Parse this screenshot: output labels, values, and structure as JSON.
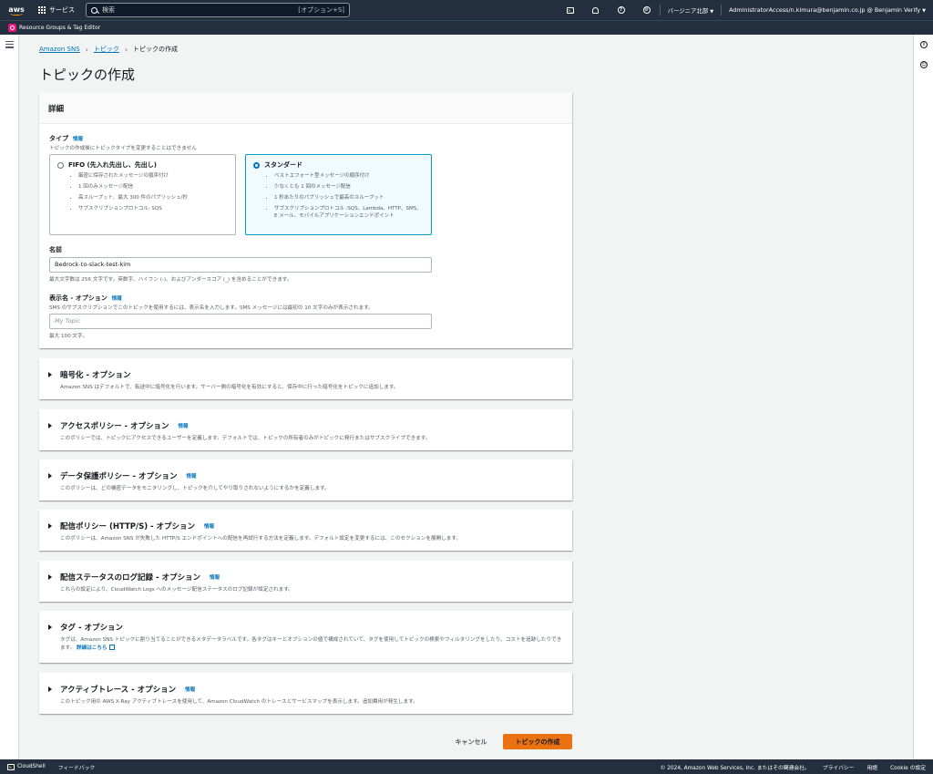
{
  "topnav": {
    "logo": "aws",
    "services": "サービス",
    "search_placeholder": "検索",
    "search_shortcut": "[オプション+S]",
    "region": "バージニア北部",
    "account": "AdministratorAccess/n.kimura@benjamin.co.jp @ Benjamin Verify"
  },
  "subnav": {
    "label": "Resource Groups & Tag Editor"
  },
  "breadcrumb": {
    "item1": "Amazon SNS",
    "item2": "トピック",
    "current": "トピックの作成"
  },
  "page_title": "トピックの作成",
  "details": {
    "header": "詳細",
    "type_label": "タイプ",
    "info": "情報",
    "type_desc": "トピックの作成後にトピックタイプを変更することはできません",
    "fifo": {
      "title": "FIFO (先入れ先出し、先出し)",
      "bullets": [
        "厳密に保存されたメッセージの順序付け",
        "1 回のみメッセージ配信",
        "高スループット、最大 300 件のパブリッシュ/秒",
        "サブスクリプションプロトコル: SQS"
      ]
    },
    "standard": {
      "title": "スタンダード",
      "bullets": [
        "ベストエフォート型メッセージの順序付け",
        "少なくとも 1 回のメッセージ配信",
        "1 秒あたりのパブリッシュで最高のスループット",
        "サブスクリプションプロトコル :SQS、Lambda、HTTP、SMS、E メール、モバイルアプリケーションエンドポイント"
      ]
    },
    "name_label": "名前",
    "name_value": "Bedrock-to-slack-test-kim",
    "name_hint": "最大文字数は 256 文字です。英数字、ハイフン (-)、およびアンダースコア (_) を含めることができます。",
    "display_label": "表示名 - オプション",
    "display_desc": "SMS のサブスクリプションでこのトピックを使用するには、表示名を入力します。SMS メッセージには最初の 10 文字のみが表示されます。",
    "display_placeholder": "My Topic",
    "display_hint": "最大 100 文字。"
  },
  "sections": [
    {
      "title": "暗号化 - オプション",
      "info": "",
      "desc": "Amazon SNS はデフォルトで、転送中に暗号化を行います。サーバー側の暗号化を有効にすると、保存中に行った暗号化をトピックに追加します。"
    },
    {
      "title": "アクセスポリシー - オプション",
      "info": "情報",
      "desc": "このポリシーでは、トピックにアクセスできるユーザーを定義します。デフォルトでは、トピックの所有者のみがトピックに発行またはサブスクライブできます。"
    },
    {
      "title": "データ保護ポリシー - オプション",
      "info": "情報",
      "desc": "このポリシーは、どの機密データをモニタリングし、トピックを介してやり取りされないようにするかを定義します。"
    },
    {
      "title": "配信ポリシー (HTTP/S) - オプション",
      "info": "情報",
      "desc": "このポリシーは、Amazon SNS が失敗した HTTP/S エンドポイントへの配信を再試行する方法を定義します。デフォルト設定を変更するには、このセクションを展開します。"
    },
    {
      "title": "配信ステータスのログ記録 - オプション",
      "info": "情報",
      "desc": "これらの設定により、CloudWatch Logs へのメッセージ配信ステータスのログ記録が設定されます。"
    },
    {
      "title": "タグ - オプション",
      "info": "",
      "desc": "タグは、Amazon SNS トピックに割り当てることができるメタデータラベルです。各タグはキーとオプションの値で構成されていて、タグを使用してトピックの検索やフィルタリングをしたり、コストを追跡したりできます。",
      "link": "詳細はこちら"
    },
    {
      "title": "アクティブトレース - オプション",
      "info": "情報",
      "desc": "このトピック用の AWS X-Ray アクティブトレースを使用して、Amazon CloudWatch のトレースとサービスマップを表示します。追加費用が発生します。"
    }
  ],
  "buttons": {
    "cancel": "キャンセル",
    "create": "トピックの作成"
  },
  "footer": {
    "cloudshell": "CloudShell",
    "feedback": "フィードバック",
    "copyright": "© 2024, Amazon Web Services, Inc. またはその関連会社。",
    "privacy": "プライバシー",
    "terms": "用語",
    "cookie": "Cookie の設定"
  },
  "colors": {
    "nav": "#232f3e",
    "accent": "#ec7211",
    "link": "#0073bb",
    "selected_border": "#00a1c9"
  },
  "icons": [
    "aws-logo",
    "services-grid-icon",
    "search-icon",
    "cloudshell-icon",
    "notifications-icon",
    "help-icon",
    "settings-icon",
    "resource-groups-icon",
    "menu-icon",
    "info-icon",
    "feedback-icon",
    "external-link-icon"
  ]
}
